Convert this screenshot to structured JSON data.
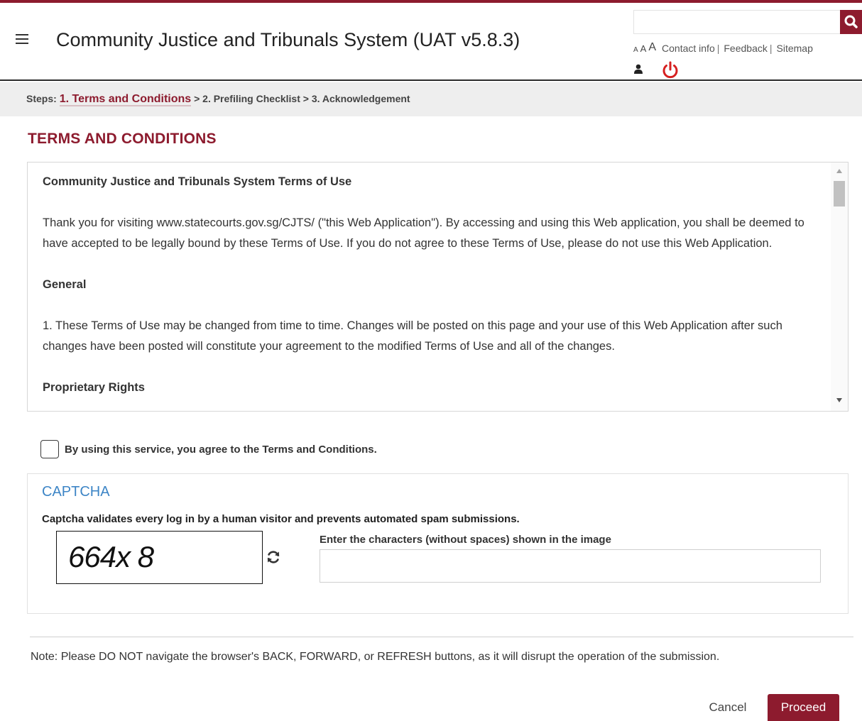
{
  "header": {
    "app_title": "Community Justice and Tribunals System (UAT v5.8.3)",
    "search_placeholder": "",
    "font_size_small": "A",
    "font_size_medium": "A",
    "font_size_large": "A",
    "links": {
      "contact": "Contact info",
      "feedback": "Feedback",
      "sitemap": "Sitemap"
    },
    "separator": "|",
    "icons": {
      "menu": "hamburger-menu-icon",
      "search": "magnifier-icon",
      "user": "user-icon",
      "power": "power-icon"
    }
  },
  "steps": {
    "prefix": "Steps:",
    "step1": "1. Terms and Conditions",
    "arrow": ">",
    "step2": "2. Prefiling Checklist",
    "step3": "3. Acknowledgement"
  },
  "page": {
    "heading": "TERMS AND CONDITIONS"
  },
  "terms": {
    "title": "Community Justice and Tribunals System Terms of Use",
    "intro": "Thank you for visiting www.statecourts.gov.sg/CJTS/ (\"this Web Application\"). By accessing and using this Web application, you shall be deemed to have accepted to be legally bound by these Terms of Use. If you do not agree to these Terms of Use, please do not use this Web Application.",
    "general_heading": "General",
    "general_1": "1. These Terms of Use may be changed from time to time. Changes will be posted on this page and your use of this Web Application after such changes have been posted will constitute your agreement to the modified Terms of Use and all of the changes.",
    "proprietary_heading": "Proprietary Rights"
  },
  "agreement": {
    "label": "By using this service, you agree to the Terms and Conditions.",
    "checked": false
  },
  "captcha": {
    "title": "CAPTCHA",
    "description": "Captcha validates every log in by a human visitor and prevents automated spam submissions.",
    "image_text": "664x 8",
    "field_label": "Enter the characters (without spaces) shown in the image",
    "input_value": ""
  },
  "footer": {
    "note": "Note: Please DO NOT navigate the browser's BACK, FORWARD, or REFRESH buttons, as it will disrupt the operation of the submission.",
    "cancel_label": "Cancel",
    "proceed_label": "Proceed"
  },
  "colors": {
    "brand": "#8d1b2e",
    "captcha_title": "#3d85c6",
    "steps_bar": "#eeeeee"
  }
}
